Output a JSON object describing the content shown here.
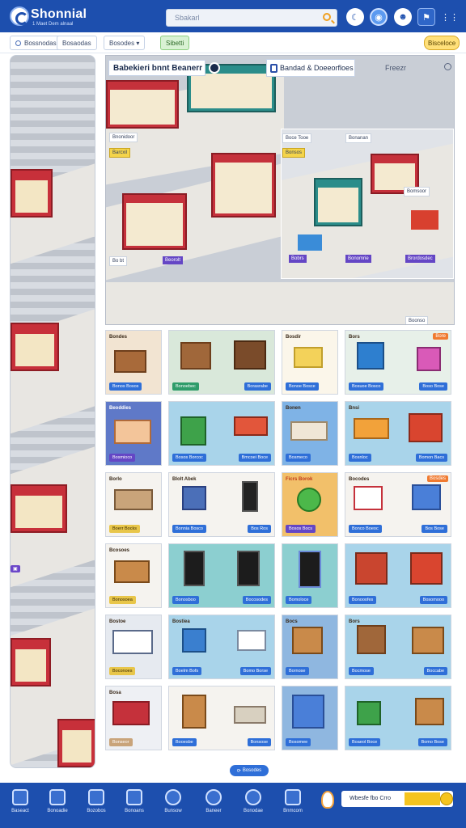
{
  "header": {
    "title": "Shonnial",
    "subtitle": "1 Maet Dem alnaal",
    "search_placeholder": "Sbakarl",
    "colors": {
      "bar": "#1d4fae",
      "accent": "#f5c41f"
    }
  },
  "filters": [
    {
      "label": "Bossnodas",
      "icon": "radio-icon"
    },
    {
      "label": "Bosaodas"
    },
    {
      "label": "Bosodes ▾"
    },
    {
      "label": "Sibetti"
    },
    {
      "label": "Bisceloce"
    }
  ],
  "main": {
    "banner_left": "Babekieri bnnt Beanerr",
    "banner_right": "Bandad & Doeeorfloes",
    "help": "Freezr",
    "stickers": [
      "Bnonidoor",
      "Barcxil",
      "Bo bt",
      "Beorolt",
      "Boce Tooe",
      "Bonsos",
      "Bonanan",
      "Bomsoor",
      "Bobrs",
      "Bonomrie",
      "Brordosdec",
      "Boonso"
    ]
  },
  "products": [
    {
      "price": "Bondes",
      "labels": [
        "Bonos Bosos"
      ]
    },
    {
      "price": "",
      "labels": [
        "Bonoebec",
        "Borasrabe"
      ]
    },
    {
      "price": "Bosdir",
      "labels": [
        "Bonoe Bosce"
      ]
    },
    {
      "price": "Bors",
      "badge": "Bore",
      "labels": [
        "Bosuoe Bosco",
        "Boso Bose"
      ]
    },
    {
      "price": "Beoddies",
      "labels": [
        "Bosmioco"
      ]
    },
    {
      "price": "",
      "labels": [
        "Bosos Borcoc",
        "Bmcoei Boce"
      ]
    },
    {
      "price": "Bonen",
      "labels": [
        "Bosmeco"
      ]
    },
    {
      "price": "Bnsi",
      "labels": [
        "Bosnloc",
        "Bomon Bacs"
      ]
    },
    {
      "price": "Borlo",
      "labels": [
        "Boerr Bocks"
      ]
    },
    {
      "price": "Blolt Abek",
      "labels": [
        "Bonnia Bosco",
        "Bos Ros"
      ]
    },
    {
      "price": "Ficrs Borok",
      "labels": [
        "Bosos Bocs"
      ]
    },
    {
      "price": "Bocodes",
      "badge": "Bosdes",
      "labels": [
        "Bonco Boeoc",
        "Bos Bose"
      ]
    },
    {
      "price": "Bcosoes",
      "labels": [
        "Bonosoea"
      ]
    },
    {
      "price": "",
      "labels": [
        "Bonosboo",
        "Bocosodes"
      ]
    },
    {
      "price": "",
      "labels": [
        "Bomoloce"
      ]
    },
    {
      "price": "",
      "labels": [
        "Bonooofes",
        "Bosomooo"
      ]
    },
    {
      "price": "Bostoe",
      "labels": [
        "Boconoes"
      ]
    },
    {
      "price": "Bostiea",
      "labels": [
        "Boelm Bofs",
        "Bomo Borse"
      ]
    },
    {
      "price": "Bocs",
      "labels": [
        "Bornose"
      ]
    },
    {
      "price": "Bors",
      "labels": [
        "Bocmose",
        "Boccabe"
      ]
    },
    {
      "price": "Bosa",
      "labels": [
        "Bonseor"
      ]
    },
    {
      "price": "",
      "labels": [
        "Booesbe",
        "Bonsose"
      ]
    },
    {
      "price": "",
      "labels": [
        "Bosomee"
      ]
    },
    {
      "price": "",
      "labels": [
        "Boaeol Boce",
        "Bomo Bose"
      ]
    }
  ],
  "load_more": "Bosodes",
  "bottom_nav": [
    {
      "label": "Baseact",
      "icon": "store-icon"
    },
    {
      "label": "Bonoadie",
      "icon": "shop-icon"
    },
    {
      "label": "Bozobos",
      "icon": "gift-icon"
    },
    {
      "label": "Bonoans",
      "icon": "building-icon"
    },
    {
      "label": "Bunsow",
      "icon": "globe-icon"
    },
    {
      "label": "Baneer",
      "icon": "target-icon"
    },
    {
      "label": "Bonodae",
      "icon": "cart-icon"
    },
    {
      "label": "Bnmcom",
      "icon": "list-icon"
    }
  ],
  "cart": {
    "label": "Wbesfe fbo Crro"
  }
}
